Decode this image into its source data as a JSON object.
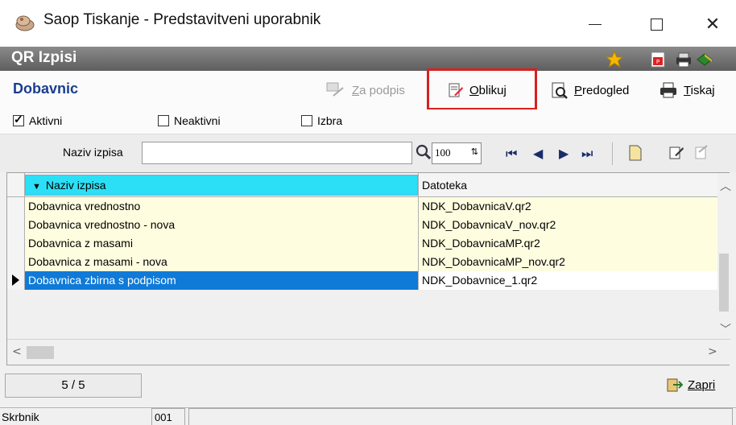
{
  "window": {
    "title": "Saop Tiskanje - Predstavitveni uporabnik",
    "minimize_icon": "minimize-icon",
    "maximize_icon": "maximize-icon",
    "close_icon": "close-icon"
  },
  "header": {
    "title": "QR Izpisi",
    "icons": [
      "star-icon",
      "pdf-icon",
      "printer-stack-icon",
      "book-icon"
    ]
  },
  "toolbar": {
    "section_title": "Dobavnic",
    "za_podpis_label": "Za podpis",
    "oblikuj_label": "Oblikuj",
    "predogled_label": "Predogled",
    "tiskaj_label": "Tiskaj"
  },
  "filters": {
    "aktivni": {
      "label": "Aktivni",
      "checked": true
    },
    "neaktivni": {
      "label": "Neaktivni",
      "checked": false
    },
    "izbra": {
      "label": "Izbra",
      "checked": false
    }
  },
  "search": {
    "label": "Naziv izpisa",
    "value": "",
    "zoom_value": "100"
  },
  "grid": {
    "columns": [
      "Naziv izpisa",
      "Datoteka"
    ],
    "rows": [
      {
        "naziv": "Dobavnica vrednostno",
        "datoteka": "NDK_DobavnicaV.qr2",
        "selected": false
      },
      {
        "naziv": "Dobavnica vrednostno - nova",
        "datoteka": "NDK_DobavnicaV_nov.qr2",
        "selected": false
      },
      {
        "naziv": "Dobavnica z masami",
        "datoteka": "NDK_DobavnicaMP.qr2",
        "selected": false
      },
      {
        "naziv": "Dobavnica z masami - nova",
        "datoteka": "NDK_DobavnicaMP_nov.qr2",
        "selected": false
      },
      {
        "naziv": "Dobavnica zbirna s podpisom",
        "datoteka": "NDK_Dobavnice_1.qr2",
        "selected": true
      }
    ]
  },
  "footer": {
    "counter": "5 / 5",
    "close_label": "Zapri"
  },
  "status": {
    "user": "Skrbnik",
    "code": "001"
  },
  "colors": {
    "highlight": "#d92020",
    "header_col_bg": "#2be0f6",
    "selected_row_bg": "#0f7ad8",
    "row_bg": "#fffde0",
    "section_title": "#1a3d8f"
  }
}
